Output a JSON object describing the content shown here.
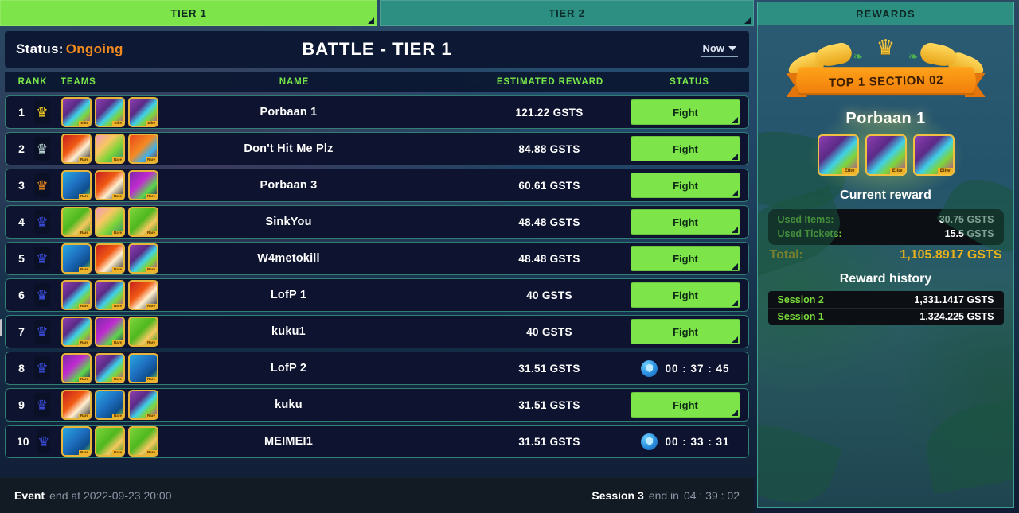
{
  "tabs": [
    {
      "label": "TIER 1",
      "active": true
    },
    {
      "label": "TIER 2",
      "active": false
    }
  ],
  "status_bar": {
    "status_label": "Status:",
    "status_value": "Ongoing",
    "title": "BATTLE - TIER 1",
    "time_filter": "Now"
  },
  "columns": {
    "rank": "RANK",
    "teams": "TEAMS",
    "name": "NAME",
    "reward": "ESTIMATED REWARD",
    "status": "STATUS"
  },
  "rows": [
    {
      "rank": "1",
      "name": "Porbaan 1",
      "reward": "121.22 GSTS",
      "action": "Fight",
      "timer": "",
      "crown": "gold",
      "avatars": [
        "a-violet",
        "a-violet",
        "a-violet"
      ],
      "tags": [
        "Elite",
        "Elite",
        "Elite"
      ]
    },
    {
      "rank": "2",
      "name": "Don't Hit Me Plz",
      "reward": "84.88 GSTS",
      "action": "Fight",
      "timer": "",
      "crown": "silver",
      "avatars": [
        "a-fire",
        "a-pink",
        "a-orange"
      ],
      "tags": [
        "Rare",
        "Rare",
        "Rare"
      ]
    },
    {
      "rank": "3",
      "name": "Porbaan 3",
      "reward": "60.61 GSTS",
      "action": "Fight",
      "timer": "",
      "crown": "bronze",
      "avatars": [
        "a-blue",
        "a-fire",
        "a-magenta"
      ],
      "tags": [
        "Rare",
        "Rare",
        "Rare"
      ]
    },
    {
      "rank": "4",
      "name": "SinkYou",
      "reward": "48.48 GSTS",
      "action": "Fight",
      "timer": "",
      "crown": "blue",
      "avatars": [
        "a-green",
        "a-pink",
        "a-green"
      ],
      "tags": [
        "Rare",
        "Rare",
        "Rare"
      ]
    },
    {
      "rank": "5",
      "name": "W4metokill",
      "reward": "48.48 GSTS",
      "action": "Fight",
      "timer": "",
      "crown": "blue",
      "avatars": [
        "a-blue",
        "a-fire",
        "a-violet"
      ],
      "tags": [
        "Rare",
        "Rare",
        "Rare"
      ]
    },
    {
      "rank": "6",
      "name": "LofP 1",
      "reward": "40 GSTS",
      "action": "Fight",
      "timer": "",
      "crown": "blue",
      "avatars": [
        "a-violet",
        "a-violet",
        "a-fire"
      ],
      "tags": [
        "Rare",
        "Rare",
        "Rare"
      ]
    },
    {
      "rank": "7",
      "name": "kuku1",
      "reward": "40 GSTS",
      "action": "Fight",
      "timer": "",
      "crown": "blue",
      "avatars": [
        "a-violet",
        "a-magenta",
        "a-green"
      ],
      "tags": [
        "Rare",
        "Rare",
        "Rare"
      ]
    },
    {
      "rank": "8",
      "name": "LofP 2",
      "reward": "31.51 GSTS",
      "action": "",
      "timer": "00 : 37 : 45",
      "crown": "blue",
      "avatars": [
        "a-magenta",
        "a-violet",
        "a-blue"
      ],
      "tags": [
        "Rare",
        "Rare",
        "Rare"
      ]
    },
    {
      "rank": "9",
      "name": "kuku",
      "reward": "31.51 GSTS",
      "action": "Fight",
      "timer": "",
      "crown": "blue",
      "avatars": [
        "a-fire",
        "a-blue",
        "a-violet"
      ],
      "tags": [
        "Rare",
        "Rare",
        "Rare"
      ]
    },
    {
      "rank": "10",
      "name": "MEIMEI1",
      "reward": "31.51 GSTS",
      "action": "",
      "timer": "00 : 33 : 31",
      "crown": "blue",
      "avatars": [
        "a-blue",
        "a-green",
        "a-green"
      ],
      "tags": [
        "Rare",
        "Rare",
        "Rare"
      ]
    }
  ],
  "footer": {
    "event_label": "Event",
    "event_text": "end at 2022-09-23 20:00",
    "session_label": "Session 3",
    "session_text": "end in",
    "session_timer": "04 : 39 : 02"
  },
  "rewards": {
    "header": "REWARDS",
    "banner_text": "TOP 1 SECTION 02",
    "winner_name": "Porbaan 1",
    "winner_tags": [
      "Elite",
      "Elite",
      "Elite"
    ],
    "current_reward_title": "Current reward",
    "lines": [
      {
        "key": "Used Items:",
        "value": "30.75 GSTS"
      },
      {
        "key": "Used Tickets:",
        "value": "15.5 GSTS"
      }
    ],
    "total_key": "Total:",
    "total_value": "1,105.8917 GSTS",
    "history_title": "Reward history",
    "history": [
      {
        "key": "Session 2",
        "value": "1,331.1417 GSTS"
      },
      {
        "key": "Session 1",
        "value": "1,324.225 GSTS"
      }
    ]
  },
  "colors": {
    "accent_green": "#7de54a",
    "tab_inactive": "#2d8f81",
    "status_orange": "#f08a1e",
    "gold": "#e8b21c",
    "row_border": "#2f7f72",
    "header_green": "#78e84a"
  }
}
